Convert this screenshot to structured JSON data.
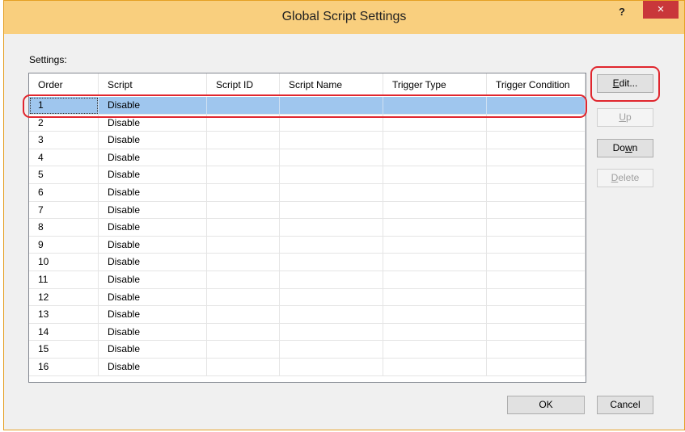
{
  "dialog": {
    "title": "Global Script Settings",
    "help_label": "?",
    "close_label": "×"
  },
  "settings_label": "Settings:",
  "table": {
    "headers": [
      "Order",
      "Script",
      "Script ID",
      "Script Name",
      "Trigger Type",
      "Trigger Condition"
    ],
    "rows": [
      {
        "order": "1",
        "script": "Disable"
      },
      {
        "order": "2",
        "script": "Disable"
      },
      {
        "order": "3",
        "script": "Disable"
      },
      {
        "order": "4",
        "script": "Disable"
      },
      {
        "order": "5",
        "script": "Disable"
      },
      {
        "order": "6",
        "script": "Disable"
      },
      {
        "order": "7",
        "script": "Disable"
      },
      {
        "order": "8",
        "script": "Disable"
      },
      {
        "order": "9",
        "script": "Disable"
      },
      {
        "order": "10",
        "script": "Disable"
      },
      {
        "order": "11",
        "script": "Disable"
      },
      {
        "order": "12",
        "script": "Disable"
      },
      {
        "order": "13",
        "script": "Disable"
      },
      {
        "order": "14",
        "script": "Disable"
      },
      {
        "order": "15",
        "script": "Disable"
      },
      {
        "order": "16",
        "script": "Disable"
      }
    ],
    "selected_row": 1
  },
  "buttons": {
    "edit": {
      "pre": "",
      "ul": "E",
      "post": "dit..."
    },
    "up": {
      "pre": "",
      "ul": "U",
      "post": "p"
    },
    "down": {
      "pre": "Do",
      "ul": "w",
      "post": "n"
    },
    "delete": {
      "pre": "",
      "ul": "D",
      "post": "elete"
    },
    "ok": "OK",
    "cancel": "Cancel"
  },
  "colors": {
    "title_bar": "#f9cf7e",
    "selection": "#9fc6ee",
    "highlight": "#e0262e",
    "close": "#c9373a"
  }
}
